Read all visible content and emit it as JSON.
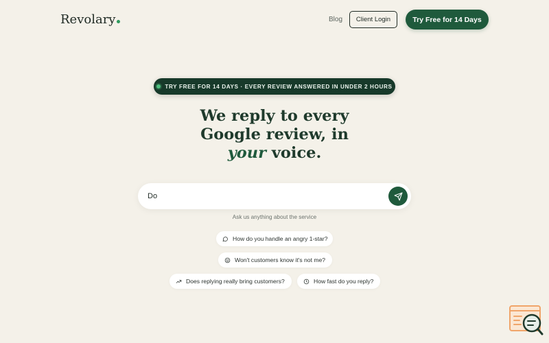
{
  "header": {
    "logo": "Revolary",
    "nav_blog": "Blog",
    "client_login": "Client Login",
    "cta": "Try Free for 14 Days"
  },
  "hero": {
    "badge": "TRY FREE FOR 14 DAYS · EVERY REVIEW ANSWERED IN UNDER 2 HOURS",
    "headline_line1": "We reply to every",
    "headline_line2": "Google review, in",
    "headline_emphasis": "your",
    "headline_end": "voice."
  },
  "search": {
    "value": "Do",
    "hint": "Ask us anything about the service"
  },
  "suggestions": [
    {
      "icon": "speech-bubble-icon",
      "label": "How do you handle an angry 1-star?"
    },
    {
      "icon": "smiley-icon",
      "label": "Won't customers know it's not me?"
    },
    {
      "icon": "trend-up-icon",
      "label": "Does replying really bring customers?"
    },
    {
      "icon": "clock-icon",
      "label": "How fast do you reply?"
    }
  ],
  "colors": {
    "background": "#f4f1e9",
    "brand_green": "#1f5a3c",
    "dark_green": "#17392a",
    "accent_dot": "#2f9a5e",
    "widget_orange": "#f0a56a"
  }
}
